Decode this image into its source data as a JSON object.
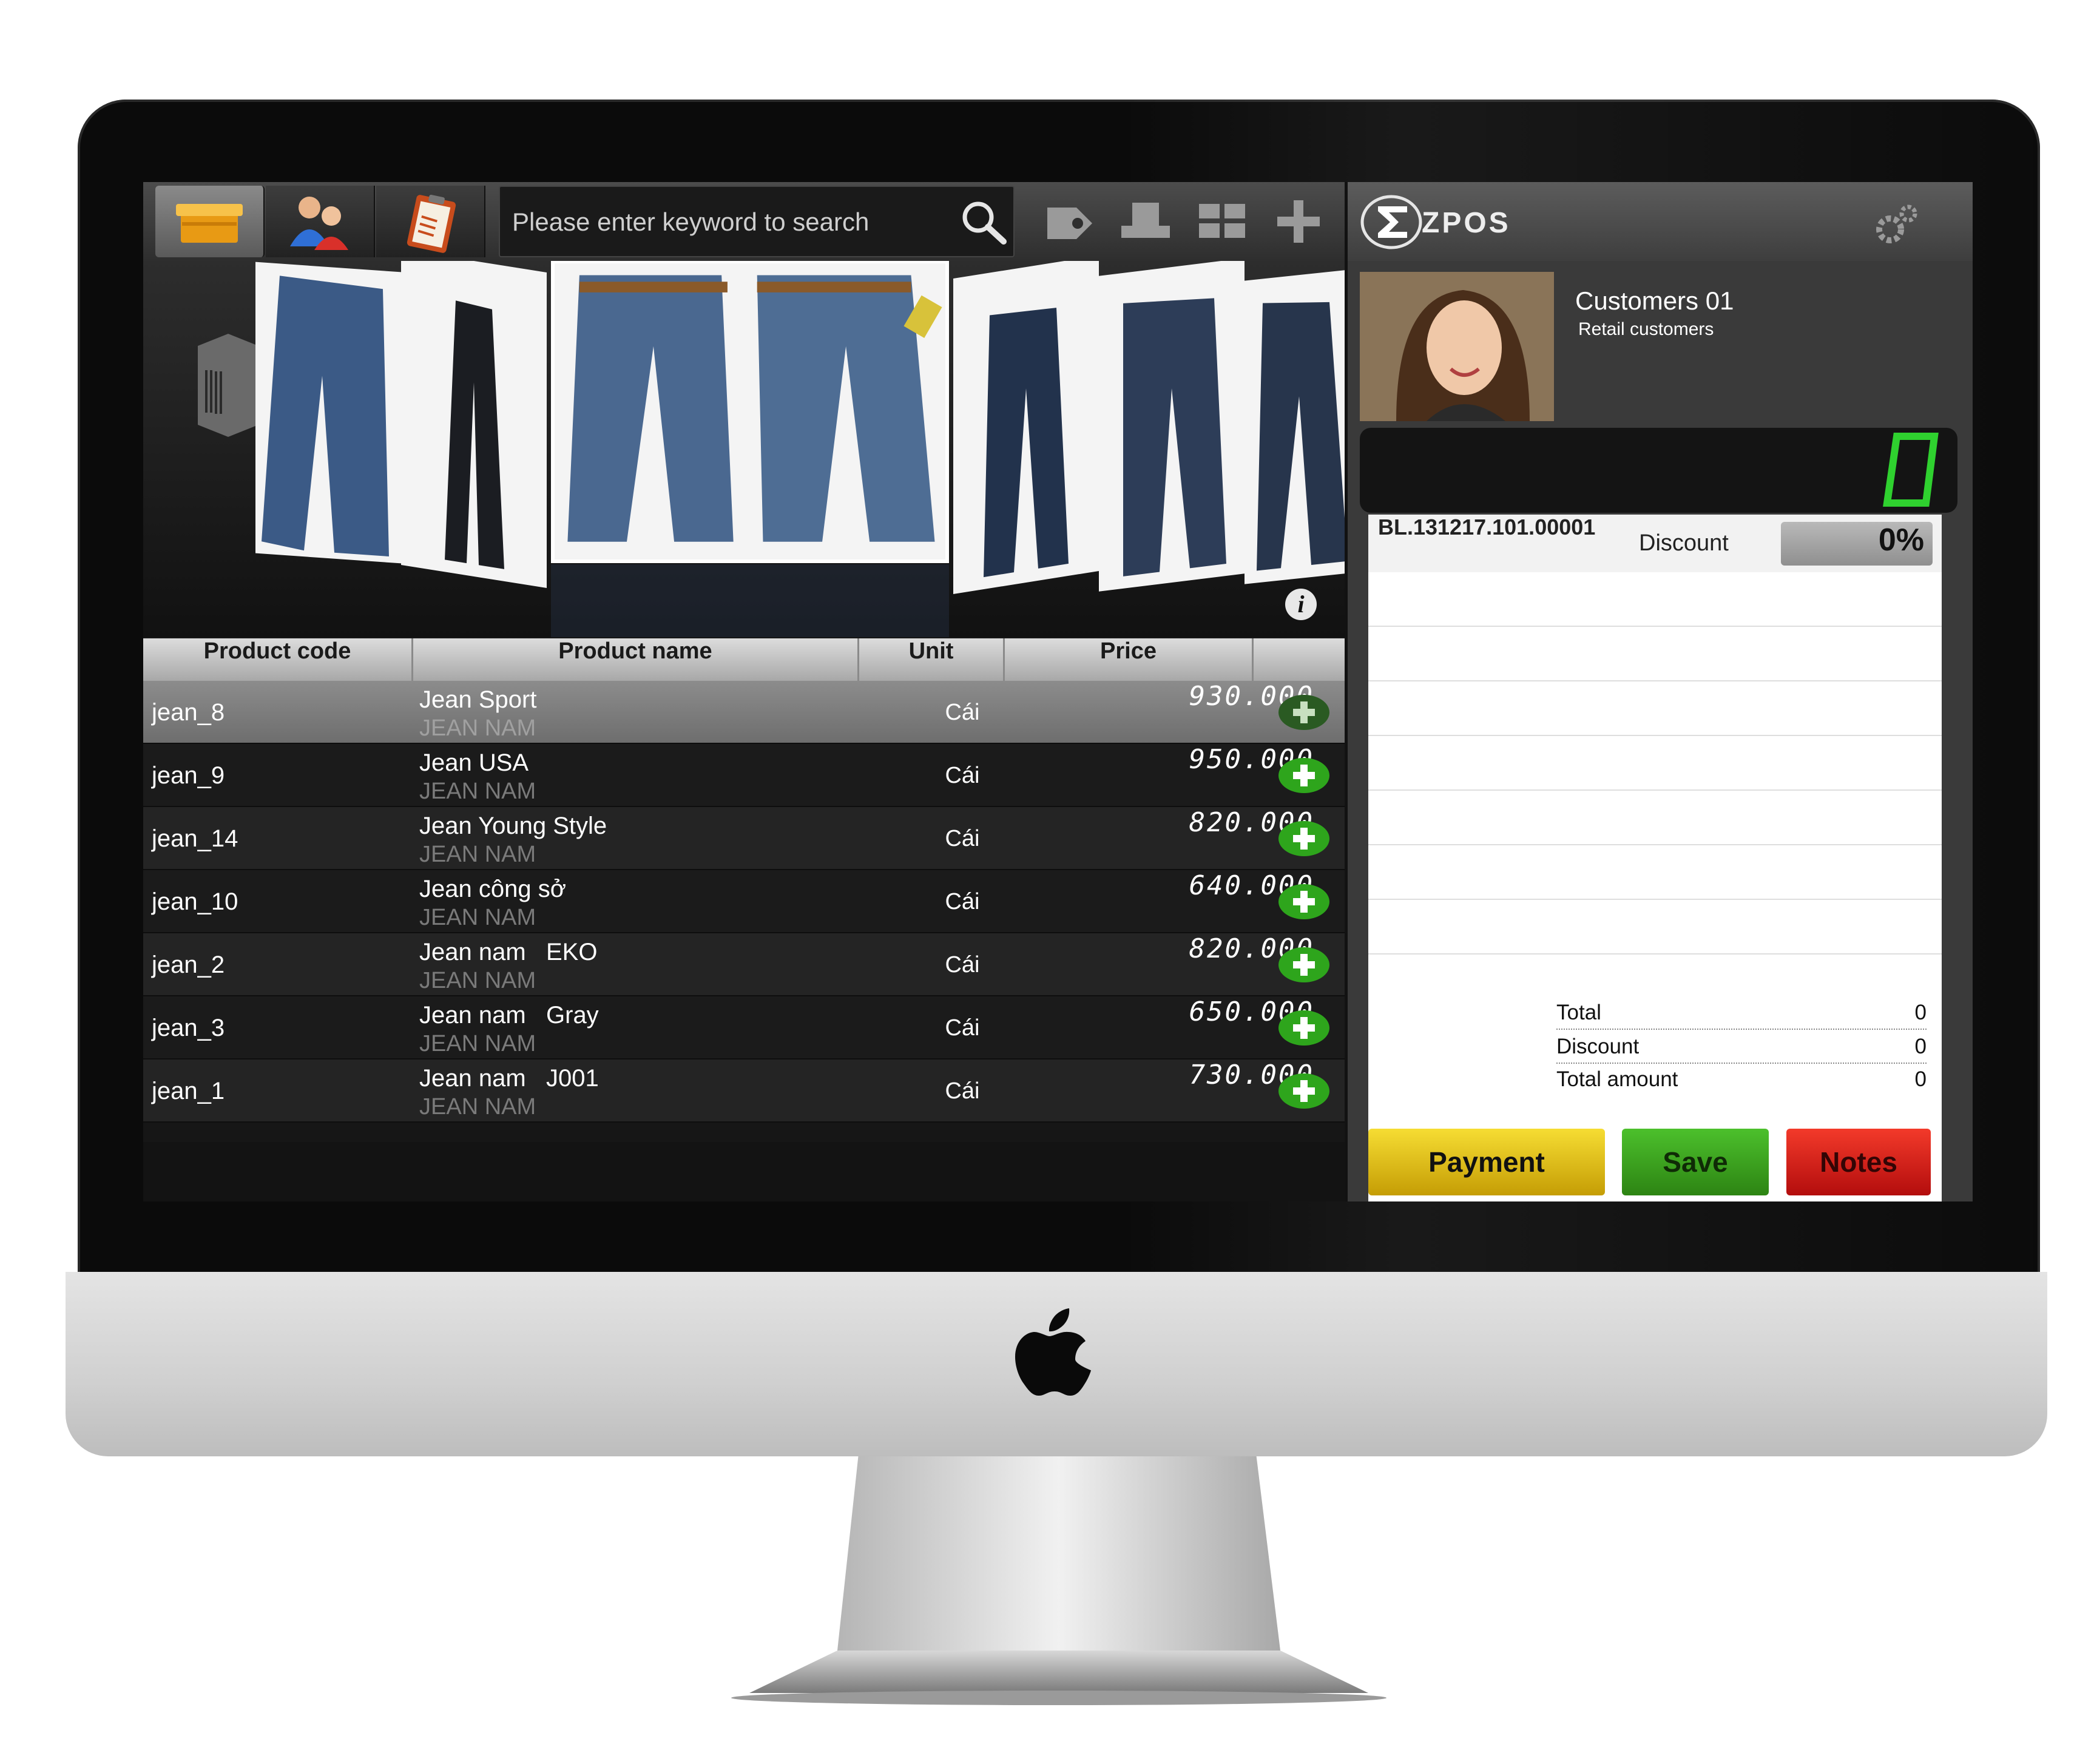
{
  "toolbar": {
    "search_placeholder": "Please enter keyword to search"
  },
  "table": {
    "headers": [
      "Product code",
      "Product name",
      "Unit",
      "Price"
    ],
    "rows": [
      {
        "code": "jean_8",
        "name": "Jean Sport",
        "category": "JEAN NAM",
        "unit": "Cái",
        "price": "930.000"
      },
      {
        "code": "jean_9",
        "name": "Jean USA",
        "category": "JEAN NAM",
        "unit": "Cái",
        "price": "950.000"
      },
      {
        "code": "jean_14",
        "name": "Jean Young Style",
        "category": "JEAN NAM",
        "unit": "Cái",
        "price": "820.000"
      },
      {
        "code": "jean_10",
        "name": "Jean công sở",
        "category": "JEAN NAM",
        "unit": "Cái",
        "price": "640.000"
      },
      {
        "code": "jean_2",
        "name": "Jean nam   EKO",
        "category": "JEAN NAM",
        "unit": "Cái",
        "price": "820.000"
      },
      {
        "code": "jean_3",
        "name": "Jean nam   Gray",
        "category": "JEAN NAM",
        "unit": "Cái",
        "price": "650.000"
      },
      {
        "code": "jean_1",
        "name": "Jean nam   J001",
        "category": "JEAN NAM",
        "unit": "Cái",
        "price": "730.000"
      }
    ]
  },
  "brand": {
    "name": "ZPOS"
  },
  "customer": {
    "name": "Customers 01",
    "type": "Retail customers"
  },
  "counter": {
    "value": "0",
    "color": "#2fd12f"
  },
  "bill": {
    "id": "BL.131217.101.00001",
    "discount_label": "Discount",
    "discount_value": "0%"
  },
  "totals": [
    {
      "label": "Total",
      "value": "0"
    },
    {
      "label": "Discount",
      "value": "0"
    },
    {
      "label": "Total amount",
      "value": "0"
    }
  ],
  "actions": {
    "payment": "Payment",
    "save": "Save",
    "notes": "Notes"
  },
  "colors": {
    "payment": "#e8c51a",
    "save": "#3aa61f",
    "notes": "#d91f17",
    "add_button": "#2ea51c"
  },
  "icons": [
    "box-icon",
    "customers-icon",
    "clipboard-icon",
    "search-icon",
    "tag-icon",
    "printer-icon",
    "grid-icon",
    "plus-icon",
    "settings-icon",
    "info-icon",
    "apple-logo-icon"
  ]
}
